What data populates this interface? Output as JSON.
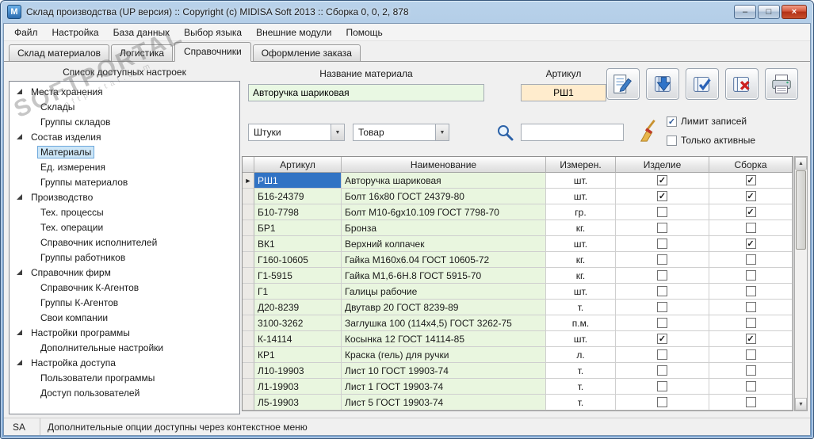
{
  "window": {
    "title": "Склад производства (UP версия) :: Copyright (c) MIDISA Soft 2013 :: Сборка 0, 0, 2, 878",
    "icon_letter": "M",
    "buttons": [
      "minimize",
      "maximize",
      "close"
    ]
  },
  "menu": {
    "items": [
      "Файл",
      "Настройка",
      "База данных",
      "Выбор языка",
      "Внешние модули",
      "Помощь"
    ]
  },
  "tabs": {
    "items": [
      {
        "label": "Склад материалов",
        "active": false
      },
      {
        "label": "Логистика",
        "active": false
      },
      {
        "label": "Справочники",
        "active": true
      },
      {
        "label": "Оформление заказа",
        "active": false
      }
    ]
  },
  "sidebar": {
    "header": "Список доступных настроек",
    "selected": "Материалы",
    "tree": [
      {
        "label": "Места хранения",
        "children": [
          "Склады",
          "Группы складов"
        ]
      },
      {
        "label": "Состав изделия",
        "children": [
          "Материалы",
          "Ед. измерения",
          "Группы материалов"
        ]
      },
      {
        "label": "Производство",
        "children": [
          "Тех. процессы",
          "Тех. операции",
          "Справочник исполнителей",
          "Группы работников"
        ]
      },
      {
        "label": "Справочник фирм",
        "children": [
          "Справочник К-Агентов",
          "Группы К-Агентов",
          "Свои компании"
        ]
      },
      {
        "label": "Настройки программы",
        "children": [
          "Дополнительные настройки"
        ]
      },
      {
        "label": "Настройка доступа",
        "children": [
          "Пользователи программы",
          "Доступ пользователей"
        ]
      }
    ]
  },
  "form": {
    "name_label": "Название материала",
    "name_value": "Авторучка шариковая",
    "article_label": "Артикул",
    "article_value": "РШ1",
    "unit_value": "Штуки",
    "kind_value": "Товар",
    "search_value": "",
    "limit_records": {
      "label": "Лимит записей",
      "checked": true
    },
    "only_active": {
      "label": "Только активные",
      "checked": false
    }
  },
  "toolbar": {
    "buttons": [
      "edit",
      "insert",
      "apply",
      "delete",
      "print"
    ]
  },
  "table": {
    "columns": [
      "Артикул",
      "Наименование",
      "Измерен.",
      "Изделие",
      "Сборка"
    ],
    "selected_article": "РШ1",
    "rows": [
      {
        "article": "РШ1",
        "name": "Авторучка шариковая",
        "unit": "шт.",
        "product": true,
        "assembly": true
      },
      {
        "article": "Б16-24379",
        "name": "Болт 16х80 ГОСТ 24379-80",
        "unit": "шт.",
        "product": true,
        "assembly": true
      },
      {
        "article": "Б10-7798",
        "name": "Болт М10-6gх10.109 ГОСТ 7798-70",
        "unit": "гр.",
        "product": false,
        "assembly": true
      },
      {
        "article": "БР1",
        "name": "Бронза",
        "unit": "кг.",
        "product": false,
        "assembly": false
      },
      {
        "article": "ВК1",
        "name": "Верхний колпачек",
        "unit": "шт.",
        "product": false,
        "assembly": true
      },
      {
        "article": "Г160-10605",
        "name": "Гайка М160х6.04 ГОСТ 10605-72",
        "unit": "кг.",
        "product": false,
        "assembly": false
      },
      {
        "article": "Г1-5915",
        "name": "Гайка М1,6-6Н.8 ГОСТ 5915-70",
        "unit": "кг.",
        "product": false,
        "assembly": false
      },
      {
        "article": "Г1",
        "name": "Галицы рабочие",
        "unit": "шт.",
        "product": false,
        "assembly": false
      },
      {
        "article": "Д20-8239",
        "name": "Двутавр 20 ГОСТ 8239-89",
        "unit": "т.",
        "product": false,
        "assembly": false
      },
      {
        "article": "3100-3262",
        "name": "Заглушка 100 (114х4,5) ГОСТ 3262-75",
        "unit": "п.м.",
        "product": false,
        "assembly": false
      },
      {
        "article": "К-14114",
        "name": "Косынка 12 ГОСТ 14114-85",
        "unit": "шт.",
        "product": true,
        "assembly": true
      },
      {
        "article": "КР1",
        "name": "Краска (гель) для ручки",
        "unit": "л.",
        "product": false,
        "assembly": false
      },
      {
        "article": "Л10-19903",
        "name": "Лист 10 ГОСТ 19903-74",
        "unit": "т.",
        "product": false,
        "assembly": false
      },
      {
        "article": "Л1-19903",
        "name": "Лист 1 ГОСТ 19903-74",
        "unit": "т.",
        "product": false,
        "assembly": false
      },
      {
        "article": "Л5-19903",
        "name": "Лист 5 ГОСТ 19903-74",
        "unit": "т.",
        "product": false,
        "assembly": false
      }
    ]
  },
  "statusbar": {
    "user": "SA",
    "message": "Дополнительные опции доступны через контекстное меню"
  },
  "watermark": {
    "text": "SOFTPORTAL",
    "subtext": "softportal.com"
  },
  "colors": {
    "accent_blue": "#3173c4",
    "row_green": "#e9f6df",
    "article_field_bg": "#ffeccd",
    "name_field_bg": "#e9f8e3"
  }
}
